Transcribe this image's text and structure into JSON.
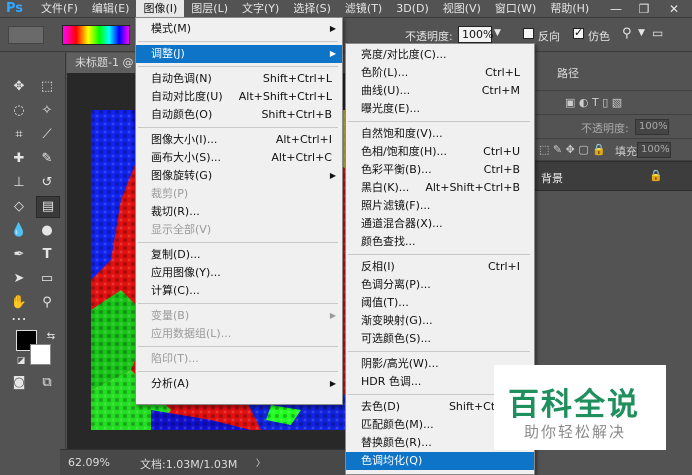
{
  "menubar": {
    "logo": "Ps",
    "items": [
      "文件(F)",
      "编辑(E)",
      "图像(I)",
      "图层(L)",
      "文字(Y)",
      "选择(S)",
      "滤镜(T)",
      "3D(D)",
      "视图(V)",
      "窗口(W)",
      "帮助(H)"
    ],
    "active_index": 2,
    "minimize": "—",
    "maximize": "❐",
    "close": "✕"
  },
  "options": {
    "opacity_label": "不透明度:",
    "opacity_value": "100%",
    "reverse_label": "反向",
    "dither_label": "仿色",
    "reverse_checked": false,
    "dither_checked": true
  },
  "document": {
    "tab_title": "未标题-1 @",
    "zoom": "62.09%",
    "doc_info": "文档:1.03M/1.03M"
  },
  "panel": {
    "tab_paths": "路径",
    "opacity_label": "不透明度:",
    "opacity_value": "100%",
    "fill_label": "填充:",
    "fill_value": "100%",
    "layer_name": "背景"
  },
  "image_menu": {
    "items": [
      {
        "label": "模式(M)",
        "shortcut": "",
        "submenu": true,
        "disabled": false,
        "highlight": false
      },
      {
        "sep": true
      },
      {
        "label": "调整(J)",
        "shortcut": "",
        "submenu": true,
        "disabled": false,
        "highlight": true
      },
      {
        "sep": true
      },
      {
        "label": "自动色调(N)",
        "shortcut": "Shift+Ctrl+L",
        "submenu": false,
        "disabled": false,
        "highlight": false
      },
      {
        "label": "自动对比度(U)",
        "shortcut": "Alt+Shift+Ctrl+L",
        "submenu": false,
        "disabled": false,
        "highlight": false
      },
      {
        "label": "自动颜色(O)",
        "shortcut": "Shift+Ctrl+B",
        "submenu": false,
        "disabled": false,
        "highlight": false
      },
      {
        "sep": true
      },
      {
        "label": "图像大小(I)...",
        "shortcut": "Alt+Ctrl+I",
        "submenu": false,
        "disabled": false,
        "highlight": false
      },
      {
        "label": "画布大小(S)...",
        "shortcut": "Alt+Ctrl+C",
        "submenu": false,
        "disabled": false,
        "highlight": false
      },
      {
        "label": "图像旋转(G)",
        "shortcut": "",
        "submenu": true,
        "disabled": false,
        "highlight": false
      },
      {
        "label": "裁剪(P)",
        "shortcut": "",
        "submenu": false,
        "disabled": true,
        "highlight": false
      },
      {
        "label": "裁切(R)...",
        "shortcut": "",
        "submenu": false,
        "disabled": false,
        "highlight": false
      },
      {
        "label": "显示全部(V)",
        "shortcut": "",
        "submenu": false,
        "disabled": true,
        "highlight": false
      },
      {
        "sep": true
      },
      {
        "label": "复制(D)...",
        "shortcut": "",
        "submenu": false,
        "disabled": false,
        "highlight": false
      },
      {
        "label": "应用图像(Y)...",
        "shortcut": "",
        "submenu": false,
        "disabled": false,
        "highlight": false
      },
      {
        "label": "计算(C)...",
        "shortcut": "",
        "submenu": false,
        "disabled": false,
        "highlight": false
      },
      {
        "sep": true
      },
      {
        "label": "变量(B)",
        "shortcut": "",
        "submenu": true,
        "disabled": true,
        "highlight": false
      },
      {
        "label": "应用数据组(L)...",
        "shortcut": "",
        "submenu": false,
        "disabled": true,
        "highlight": false
      },
      {
        "sep": true
      },
      {
        "label": "陷印(T)...",
        "shortcut": "",
        "submenu": false,
        "disabled": true,
        "highlight": false
      },
      {
        "sep": true
      },
      {
        "label": "分析(A)",
        "shortcut": "",
        "submenu": true,
        "disabled": false,
        "highlight": false
      }
    ]
  },
  "adjust_menu": {
    "items": [
      {
        "label": "亮度/对比度(C)...",
        "shortcut": "",
        "highlight": false
      },
      {
        "label": "色阶(L)...",
        "shortcut": "Ctrl+L",
        "highlight": false
      },
      {
        "label": "曲线(U)...",
        "shortcut": "Ctrl+M",
        "highlight": false
      },
      {
        "label": "曝光度(E)...",
        "shortcut": "",
        "highlight": false
      },
      {
        "sep": true
      },
      {
        "label": "自然饱和度(V)...",
        "shortcut": "",
        "highlight": false
      },
      {
        "label": "色相/饱和度(H)...",
        "shortcut": "Ctrl+U",
        "highlight": false
      },
      {
        "label": "色彩平衡(B)...",
        "shortcut": "Ctrl+B",
        "highlight": false
      },
      {
        "label": "黑白(K)...",
        "shortcut": "Alt+Shift+Ctrl+B",
        "highlight": false
      },
      {
        "label": "照片滤镜(F)...",
        "shortcut": "",
        "highlight": false
      },
      {
        "label": "通道混合器(X)...",
        "shortcut": "",
        "highlight": false
      },
      {
        "label": "颜色查找...",
        "shortcut": "",
        "highlight": false
      },
      {
        "sep": true
      },
      {
        "label": "反相(I)",
        "shortcut": "Ctrl+I",
        "highlight": false
      },
      {
        "label": "色调分离(P)...",
        "shortcut": "",
        "highlight": false
      },
      {
        "label": "阈值(T)...",
        "shortcut": "",
        "highlight": false
      },
      {
        "label": "渐变映射(G)...",
        "shortcut": "",
        "highlight": false
      },
      {
        "label": "可选颜色(S)...",
        "shortcut": "",
        "highlight": false
      },
      {
        "sep": true
      },
      {
        "label": "阴影/高光(W)...",
        "shortcut": "",
        "highlight": false
      },
      {
        "label": "HDR 色调...",
        "shortcut": "",
        "highlight": false
      },
      {
        "sep": true
      },
      {
        "label": "去色(D)",
        "shortcut": "Shift+Ctrl+U",
        "highlight": false
      },
      {
        "label": "匹配颜色(M)...",
        "shortcut": "",
        "highlight": false
      },
      {
        "label": "替换颜色(R)...",
        "shortcut": "",
        "highlight": false
      },
      {
        "label": "色调均化(Q)",
        "shortcut": "",
        "highlight": true
      }
    ]
  },
  "watermark": {
    "main": "百科全说",
    "sub": "助你轻松解决"
  },
  "colors": {
    "highlight": "#0d74c7",
    "menu_bg": "#f0f0f0",
    "app_bg": "#535353",
    "watermark_green": "#1f8f5d"
  }
}
